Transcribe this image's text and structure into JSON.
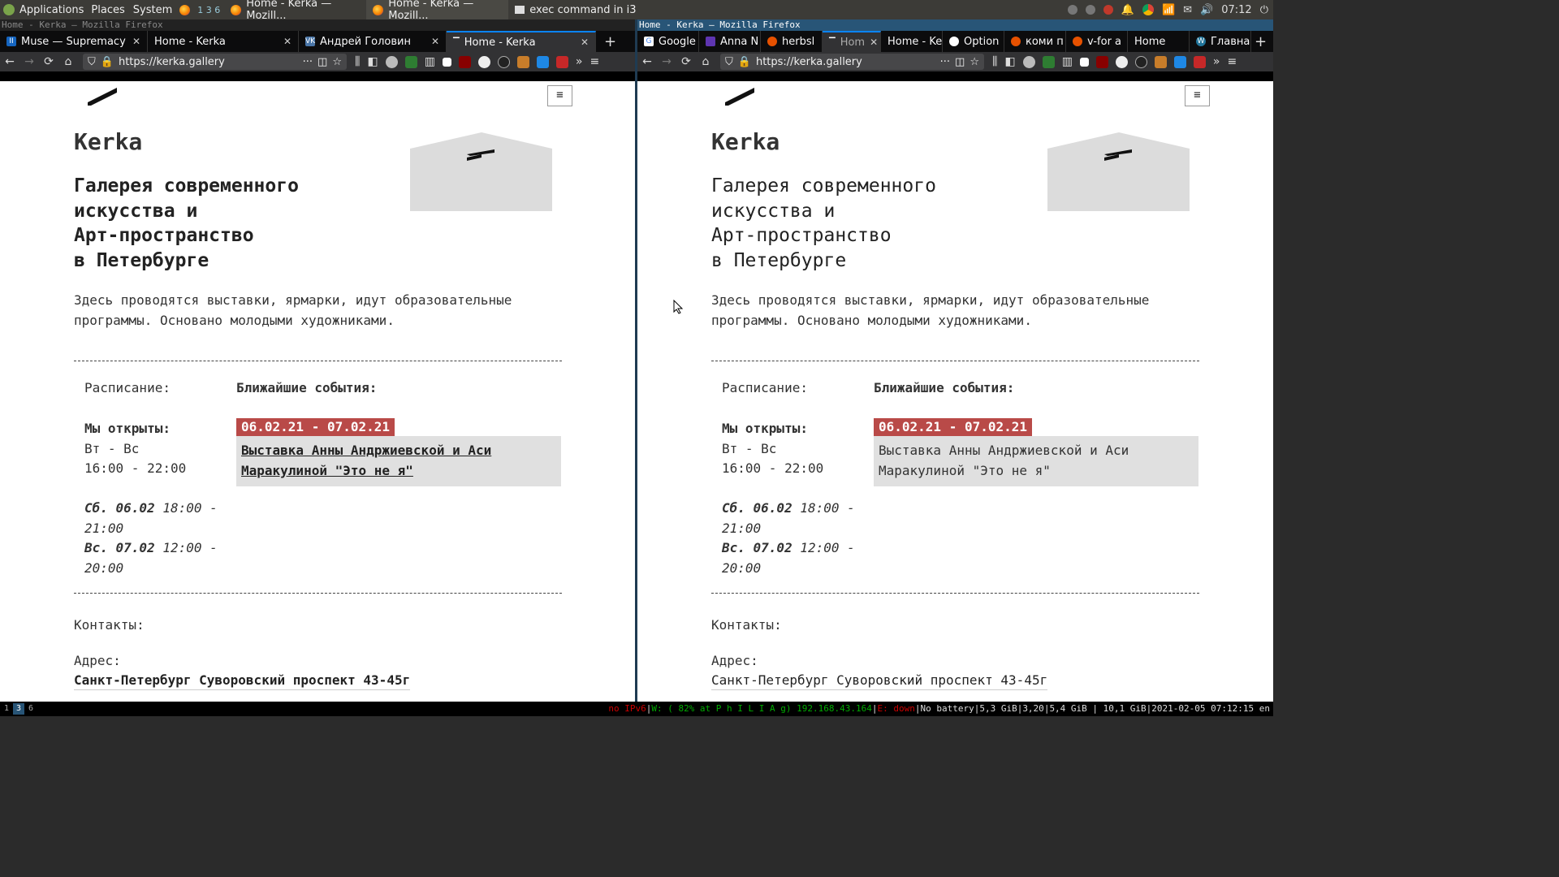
{
  "panel": {
    "menus": [
      "Applications",
      "Places",
      "System"
    ],
    "workspaces_inline": "1 3 6",
    "tasks": [
      {
        "label": "Home - Kerka — Mozill..."
      },
      {
        "label": "Home - Kerka — Mozill..."
      },
      {
        "label": "exec command in i3"
      }
    ],
    "clock": "07:12"
  },
  "left_window": {
    "title": "Home - Kerka — Mozilla Firefox",
    "tabs": [
      {
        "label": "Muse — Supremacy",
        "icon_color": "#1565c0"
      },
      {
        "label": "Home - Kerka",
        "icon_color": "#444"
      },
      {
        "label": "Андрей Головин",
        "icon_color": "#4a76a8"
      },
      {
        "label": "Home - Kerka",
        "icon_color": "#444"
      }
    ],
    "url": "https://kerka.gallery"
  },
  "right_window": {
    "title": "Home - Kerka — Mozilla Firefox",
    "tabs": [
      {
        "label": "Google",
        "icon_color": "#4285f4"
      },
      {
        "label": "Anna N",
        "icon_color": "#5e35b1"
      },
      {
        "label": "herbsl",
        "icon_color": "#e65100"
      },
      {
        "label": "Hom",
        "icon_color": "#444"
      },
      {
        "label": "Home - Ke",
        "icon_color": "#444"
      },
      {
        "label": "Option",
        "icon_color": "#fff"
      },
      {
        "label": "коми п",
        "icon_color": "#e65100"
      },
      {
        "label": "v-for a",
        "icon_color": "#e65100"
      },
      {
        "label": "Home",
        "icon_color": "#444"
      },
      {
        "label": "Главна",
        "icon_color": "#21759b"
      }
    ],
    "url": "https://kerka.gallery"
  },
  "page": {
    "site_name": "Kerka",
    "tagline_lines": [
      "Галерея современного",
      "искусства и",
      "Арт-пространство",
      "в Петербурге"
    ],
    "intro_lines": [
      "Здесь проводятся выставки, ярмарки, идут образовательные",
      "программы. Основано молодыми художниками."
    ],
    "schedule_label": "Расписание:",
    "events_label": "Ближайшие события:",
    "open_label": "Мы открыты:",
    "open_days": "Вт - Вс",
    "open_hours": "16:00 - 22:00",
    "special1_day": "Сб. 06.02",
    "special1_hours": " 18:00 -",
    "special1_cont": "21:00",
    "special2_day": "Вс. 07.02",
    "special2_hours": " 12:00 -",
    "special2_cont": "20:00",
    "event_date": "06.02.21 - 07.02.21",
    "event_title_lines": [
      "Выставка Анны Андржиевской и Аси",
      "Маракулиной \"Это не я\""
    ],
    "contacts_label": "Контакты:",
    "address_label": "Адрес:",
    "address": "Санкт-Петербург Суворовский проспект 43-45г"
  },
  "statusbar": {
    "workspaces": [
      "1",
      "3",
      "6"
    ],
    "focused_workspace": "3",
    "ipv6": "no IPv6",
    "wifi": "W: ( 82% at P h I L I A g) 192.168.43.164",
    "eth": "E: down",
    "battery": "No battery",
    "mem1": "5,3 GiB",
    "load": "3,20",
    "mem2": "5,4 GiB",
    "disk": "10,1 GiB",
    "datetime": "2021-02-05 07:12:15",
    "lang": "en"
  },
  "colors": {
    "accent_red": "#b94a48",
    "i3_focus": "#285577",
    "tab_active_line": "#0a84ff"
  }
}
